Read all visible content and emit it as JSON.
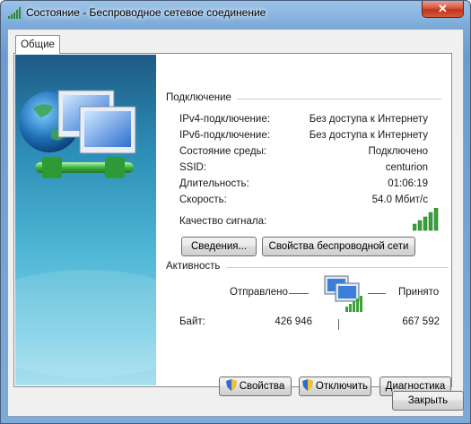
{
  "window": {
    "title": "Состояние - Беспроводное сетевое соединение",
    "close_glyph": "✕"
  },
  "tabs": [
    {
      "label": "Общие",
      "active": true
    }
  ],
  "connection": {
    "section_label": "Подключение",
    "rows": [
      {
        "label": "IPv4-подключение:",
        "value": "Без доступа к Интернету"
      },
      {
        "label": "IPv6-подключение:",
        "value": "Без доступа к Интернету"
      },
      {
        "label": "Состояние среды:",
        "value": "Подключено"
      },
      {
        "label": "SSID:",
        "value": "centurion"
      },
      {
        "label": "Длительность:",
        "value": "01:06:19"
      },
      {
        "label": "Скорость:",
        "value": "54.0 Мбит/с"
      }
    ],
    "signal_label": "Качество сигнала:",
    "signal_bars": 5,
    "signal_bars_lit": 5,
    "details_button": "Сведения...",
    "wireless_props_button": "Свойства беспроводной сети"
  },
  "activity": {
    "section_label": "Активность",
    "sent_label": "Отправлено",
    "received_label": "Принято",
    "bytes_label": "Байт:",
    "bytes_sent": "426 946",
    "bytes_received": "667 592"
  },
  "actions": {
    "properties_button": "Свойства",
    "disable_button": "Отключить",
    "diagnose_button": "Диагностика"
  },
  "footer": {
    "close_button": "Закрыть"
  },
  "colors": {
    "signal_green": "#3aa23a",
    "title_bar": "#7aa9d8",
    "close_red": "#c2311c"
  }
}
